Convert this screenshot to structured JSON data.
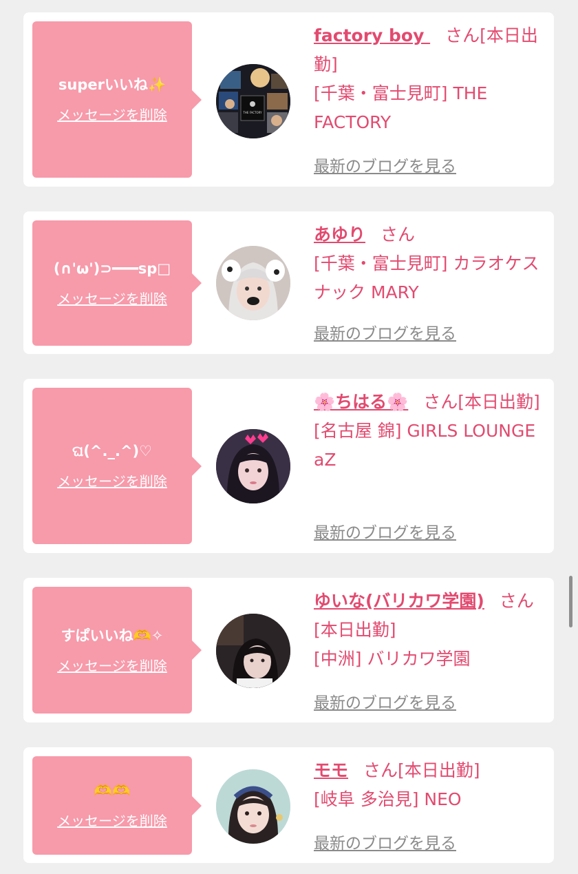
{
  "entries": [
    {
      "message": "superいいね✨",
      "delete_label": "メッセージを削除",
      "name": "factory boy ",
      "san": "さん",
      "status": "[本日出勤]",
      "location": "[千葉・富士見町] THE FACTORY",
      "blog_label": "最新のブログを見る",
      "avatar_caption": "THE FACTORY"
    },
    {
      "message": "(∩'ω')⊃━━━sp□",
      "delete_label": "メッセージを削除",
      "name": "あゆり",
      "san": "さん",
      "status": "",
      "location": "[千葉・富士見町] カラオケスナック MARY",
      "blog_label": "最新のブログを見る"
    },
    {
      "message": "ଘ(^._.^)♡",
      "delete_label": "メッセージを削除",
      "name": "🌸ちはる🌸",
      "san": "さん",
      "status": "[本日出勤]",
      "location": "[名古屋 錦] GIRLS LOUNGE aZ",
      "blog_label": "最新のブログを見る"
    },
    {
      "message": "すぱいいね🫶✧",
      "delete_label": "メッセージを削除",
      "name": "ゆいな(バリカワ学園)",
      "san": "さん",
      "status": "[本日出勤]",
      "location": "[中洲] バリカワ学園",
      "blog_label": "最新のブログを見る"
    },
    {
      "message": "🫶🫶",
      "delete_label": "メッセージを削除",
      "name": "モモ",
      "san": "さん",
      "status": "[本日出勤]",
      "location": "[岐阜 多治見] NEO",
      "blog_label": "最新のブログを見る"
    }
  ],
  "colors": {
    "accent_pink": "#e24a6f",
    "bubble_pink": "#f79aaa",
    "link_gray": "#8a8a8a",
    "background": "#efefef"
  }
}
